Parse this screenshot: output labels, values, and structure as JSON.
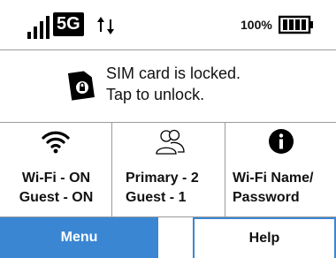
{
  "status": {
    "network_type": "5G",
    "battery_text": "100%",
    "signal_icon": "signal-bars-icon",
    "data_icon": "updown-arrows-icon",
    "battery_icon": "battery-full-icon"
  },
  "sim": {
    "icon": "sim-lock-icon",
    "line1": "SIM card is locked.",
    "line2": "Tap to unlock."
  },
  "tiles": [
    {
      "icon": "wifi-icon",
      "line1": "Wi-Fi - ON",
      "line2": "Guest - ON"
    },
    {
      "icon": "users-icon",
      "line1": "Primary - 2",
      "line2": "Guest - 1"
    },
    {
      "icon": "info-icon",
      "line1": "Wi-Fi Name/",
      "line2": "Password"
    }
  ],
  "buttons": {
    "menu": "Menu",
    "help": "Help"
  },
  "colors": {
    "accent": "#3a86d3",
    "divider": "#9a9a9a"
  }
}
